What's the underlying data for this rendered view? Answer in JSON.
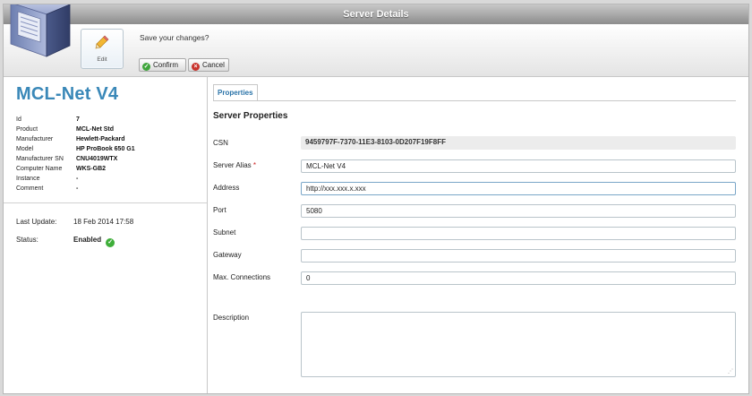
{
  "window": {
    "title": "Server Details"
  },
  "toolbar": {
    "edit_label": "Edit",
    "prompt": "Save your changes?",
    "confirm_label": "Confirm",
    "cancel_label": "Cancel"
  },
  "server": {
    "name": "MCL-Net V4",
    "info": [
      {
        "key": "Id",
        "value": "7"
      },
      {
        "key": "Product",
        "value": "MCL-Net Std"
      },
      {
        "key": "Manufacturer",
        "value": "Hewlett-Packard"
      },
      {
        "key": "Model",
        "value": "HP ProBook 650 G1"
      },
      {
        "key": "Manufacturer SN",
        "value": "CNU4019WTX"
      },
      {
        "key": "Computer Name",
        "value": "WKS-GB2"
      },
      {
        "key": "Instance",
        "value": "-"
      },
      {
        "key": "Comment",
        "value": "-"
      }
    ],
    "last_update_label": "Last Update:",
    "last_update": "18 Feb 2014 17:58",
    "status_label": "Status:",
    "status": "Enabled"
  },
  "properties": {
    "tab_label": "Properties",
    "section_title": "Server Properties",
    "csn_label": "CSN",
    "csn": "9459797F-7370-11E3-8103-0D207F19F8FF",
    "alias_label": "Server Alias",
    "alias_required": "*",
    "alias": "MCL-Net V4",
    "address_label": "Address",
    "address": "http://xxx.xxx.x.xxx",
    "port_label": "Port",
    "port": "5080",
    "subnet_label": "Subnet",
    "subnet": "",
    "gateway_label": "Gateway",
    "gateway": "",
    "maxconn_label": "Max. Connections",
    "maxconn": "0",
    "description_label": "Description",
    "description": ""
  },
  "icons": {
    "confirm": "check-circle-icon",
    "cancel": "x-circle-icon",
    "status": "check-circle-icon",
    "edit": "pencil-icon",
    "server": "server-tower-icon"
  },
  "colors": {
    "accent": "#3a88b8",
    "confirm": "#3ea53b",
    "cancel": "#c9332c"
  }
}
